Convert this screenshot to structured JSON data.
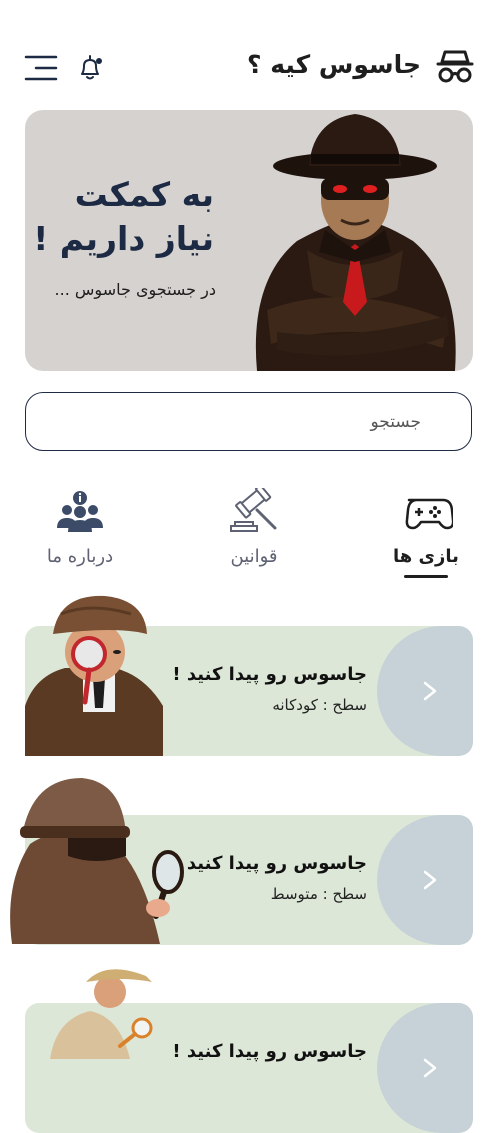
{
  "header": {
    "title": "جاسوس کیه ؟",
    "logo_icon": "spy-glasses-icon",
    "menu_icon": "menu-icon",
    "notification_icon": "bell-icon"
  },
  "hero": {
    "heading_line1": "به کمکت",
    "heading_line2": "نیاز داریم !",
    "subtitle": "در جستجوی جاسوس ..."
  },
  "search": {
    "placeholder": "جستجو"
  },
  "tabs": [
    {
      "label": "بازی ها",
      "icon": "gamepad-icon",
      "active": true
    },
    {
      "label": "قوانین",
      "icon": "gavel-icon",
      "active": false
    },
    {
      "label": "درباره ما",
      "icon": "team-info-icon",
      "active": false
    }
  ],
  "games": [
    {
      "title": "جاسوس رو پیدا کنید !",
      "level": "سطح : کودکانه"
    },
    {
      "title": "جاسوس رو پیدا کنید !",
      "level": "سطح : متوسط"
    },
    {
      "title": "جاسوس رو پیدا کنید !",
      "level": ""
    }
  ],
  "colors": {
    "navy": "#1d2a44",
    "hero_bg": "#d6d2cf",
    "card_bg": "#dde7d7",
    "card_arrow_bg": "#c6d2d8"
  }
}
